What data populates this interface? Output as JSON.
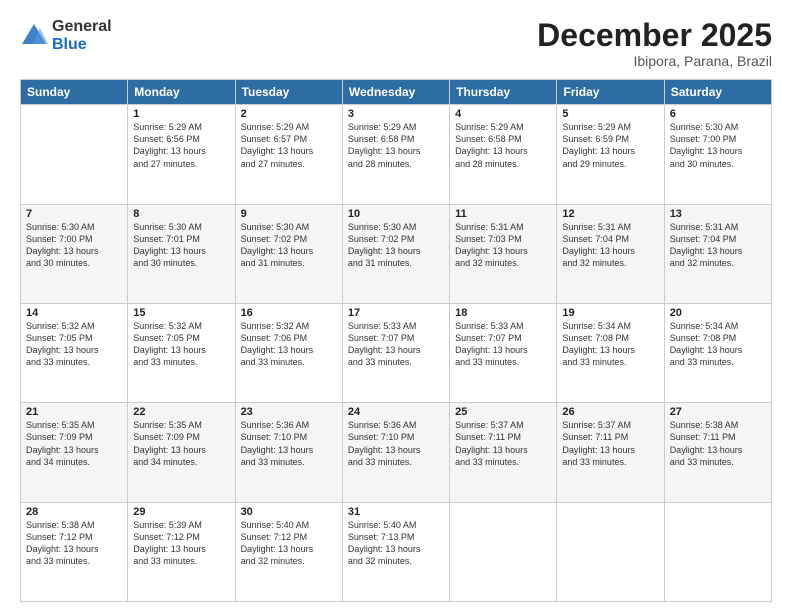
{
  "logo": {
    "general": "General",
    "blue": "Blue"
  },
  "header": {
    "month_year": "December 2025",
    "location": "Ibipora, Parana, Brazil"
  },
  "weekdays": [
    "Sunday",
    "Monday",
    "Tuesday",
    "Wednesday",
    "Thursday",
    "Friday",
    "Saturday"
  ],
  "weeks": [
    [
      {
        "day": "",
        "info": ""
      },
      {
        "day": "1",
        "info": "Sunrise: 5:29 AM\nSunset: 6:56 PM\nDaylight: 13 hours\nand 27 minutes."
      },
      {
        "day": "2",
        "info": "Sunrise: 5:29 AM\nSunset: 6:57 PM\nDaylight: 13 hours\nand 27 minutes."
      },
      {
        "day": "3",
        "info": "Sunrise: 5:29 AM\nSunset: 6:58 PM\nDaylight: 13 hours\nand 28 minutes."
      },
      {
        "day": "4",
        "info": "Sunrise: 5:29 AM\nSunset: 6:58 PM\nDaylight: 13 hours\nand 28 minutes."
      },
      {
        "day": "5",
        "info": "Sunrise: 5:29 AM\nSunset: 6:59 PM\nDaylight: 13 hours\nand 29 minutes."
      },
      {
        "day": "6",
        "info": "Sunrise: 5:30 AM\nSunset: 7:00 PM\nDaylight: 13 hours\nand 30 minutes."
      }
    ],
    [
      {
        "day": "7",
        "info": "Sunrise: 5:30 AM\nSunset: 7:00 PM\nDaylight: 13 hours\nand 30 minutes."
      },
      {
        "day": "8",
        "info": "Sunrise: 5:30 AM\nSunset: 7:01 PM\nDaylight: 13 hours\nand 30 minutes."
      },
      {
        "day": "9",
        "info": "Sunrise: 5:30 AM\nSunset: 7:02 PM\nDaylight: 13 hours\nand 31 minutes."
      },
      {
        "day": "10",
        "info": "Sunrise: 5:30 AM\nSunset: 7:02 PM\nDaylight: 13 hours\nand 31 minutes."
      },
      {
        "day": "11",
        "info": "Sunrise: 5:31 AM\nSunset: 7:03 PM\nDaylight: 13 hours\nand 32 minutes."
      },
      {
        "day": "12",
        "info": "Sunrise: 5:31 AM\nSunset: 7:04 PM\nDaylight: 13 hours\nand 32 minutes."
      },
      {
        "day": "13",
        "info": "Sunrise: 5:31 AM\nSunset: 7:04 PM\nDaylight: 13 hours\nand 32 minutes."
      }
    ],
    [
      {
        "day": "14",
        "info": "Sunrise: 5:32 AM\nSunset: 7:05 PM\nDaylight: 13 hours\nand 33 minutes."
      },
      {
        "day": "15",
        "info": "Sunrise: 5:32 AM\nSunset: 7:05 PM\nDaylight: 13 hours\nand 33 minutes."
      },
      {
        "day": "16",
        "info": "Sunrise: 5:32 AM\nSunset: 7:06 PM\nDaylight: 13 hours\nand 33 minutes."
      },
      {
        "day": "17",
        "info": "Sunrise: 5:33 AM\nSunset: 7:07 PM\nDaylight: 13 hours\nand 33 minutes."
      },
      {
        "day": "18",
        "info": "Sunrise: 5:33 AM\nSunset: 7:07 PM\nDaylight: 13 hours\nand 33 minutes."
      },
      {
        "day": "19",
        "info": "Sunrise: 5:34 AM\nSunset: 7:08 PM\nDaylight: 13 hours\nand 33 minutes."
      },
      {
        "day": "20",
        "info": "Sunrise: 5:34 AM\nSunset: 7:08 PM\nDaylight: 13 hours\nand 33 minutes."
      }
    ],
    [
      {
        "day": "21",
        "info": "Sunrise: 5:35 AM\nSunset: 7:09 PM\nDaylight: 13 hours\nand 34 minutes."
      },
      {
        "day": "22",
        "info": "Sunrise: 5:35 AM\nSunset: 7:09 PM\nDaylight: 13 hours\nand 34 minutes."
      },
      {
        "day": "23",
        "info": "Sunrise: 5:36 AM\nSunset: 7:10 PM\nDaylight: 13 hours\nand 33 minutes."
      },
      {
        "day": "24",
        "info": "Sunrise: 5:36 AM\nSunset: 7:10 PM\nDaylight: 13 hours\nand 33 minutes."
      },
      {
        "day": "25",
        "info": "Sunrise: 5:37 AM\nSunset: 7:11 PM\nDaylight: 13 hours\nand 33 minutes."
      },
      {
        "day": "26",
        "info": "Sunrise: 5:37 AM\nSunset: 7:11 PM\nDaylight: 13 hours\nand 33 minutes."
      },
      {
        "day": "27",
        "info": "Sunrise: 5:38 AM\nSunset: 7:11 PM\nDaylight: 13 hours\nand 33 minutes."
      }
    ],
    [
      {
        "day": "28",
        "info": "Sunrise: 5:38 AM\nSunset: 7:12 PM\nDaylight: 13 hours\nand 33 minutes."
      },
      {
        "day": "29",
        "info": "Sunrise: 5:39 AM\nSunset: 7:12 PM\nDaylight: 13 hours\nand 33 minutes."
      },
      {
        "day": "30",
        "info": "Sunrise: 5:40 AM\nSunset: 7:12 PM\nDaylight: 13 hours\nand 32 minutes."
      },
      {
        "day": "31",
        "info": "Sunrise: 5:40 AM\nSunset: 7:13 PM\nDaylight: 13 hours\nand 32 minutes."
      },
      {
        "day": "",
        "info": ""
      },
      {
        "day": "",
        "info": ""
      },
      {
        "day": "",
        "info": ""
      }
    ]
  ]
}
